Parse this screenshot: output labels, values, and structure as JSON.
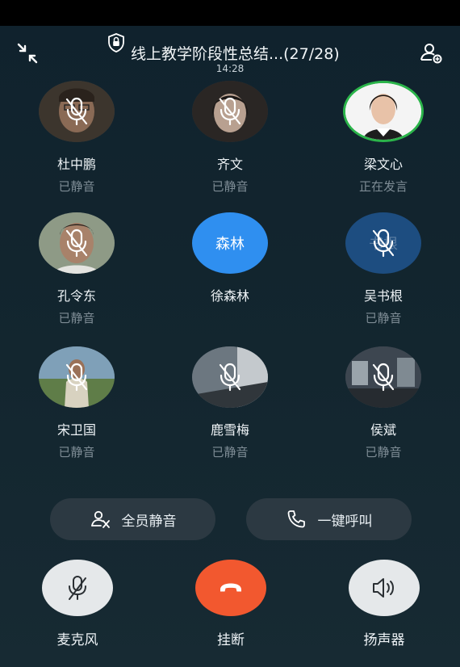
{
  "header": {
    "title": "线上教学阶段性总结...(27/28)",
    "time": "14:28"
  },
  "participants": [
    {
      "name": "杜中鹏",
      "status": "已静音"
    },
    {
      "name": "齐文",
      "status": "已静音"
    },
    {
      "name": "梁文心",
      "status": "正在发言"
    },
    {
      "name": "孔令东",
      "status": "已静音"
    },
    {
      "name": "徐森林",
      "status": "",
      "initials": "森林"
    },
    {
      "name": "吴书根",
      "status": "已静音",
      "initials": "书根"
    },
    {
      "name": "宋卫国",
      "status": "已静音"
    },
    {
      "name": "鹿雪梅",
      "status": "已静音"
    },
    {
      "name": "侯斌",
      "status": "已静音"
    }
  ],
  "actions": {
    "mute_all": "全员静音",
    "call_all": "一键呼叫"
  },
  "controls": {
    "mic": "麦克风",
    "hangup": "挂断",
    "speaker": "扬声器"
  },
  "colors": {
    "hangup": "#f2582f",
    "speaking_ring": "#2bb44a",
    "avatar_blue": "#2f8ff0"
  }
}
